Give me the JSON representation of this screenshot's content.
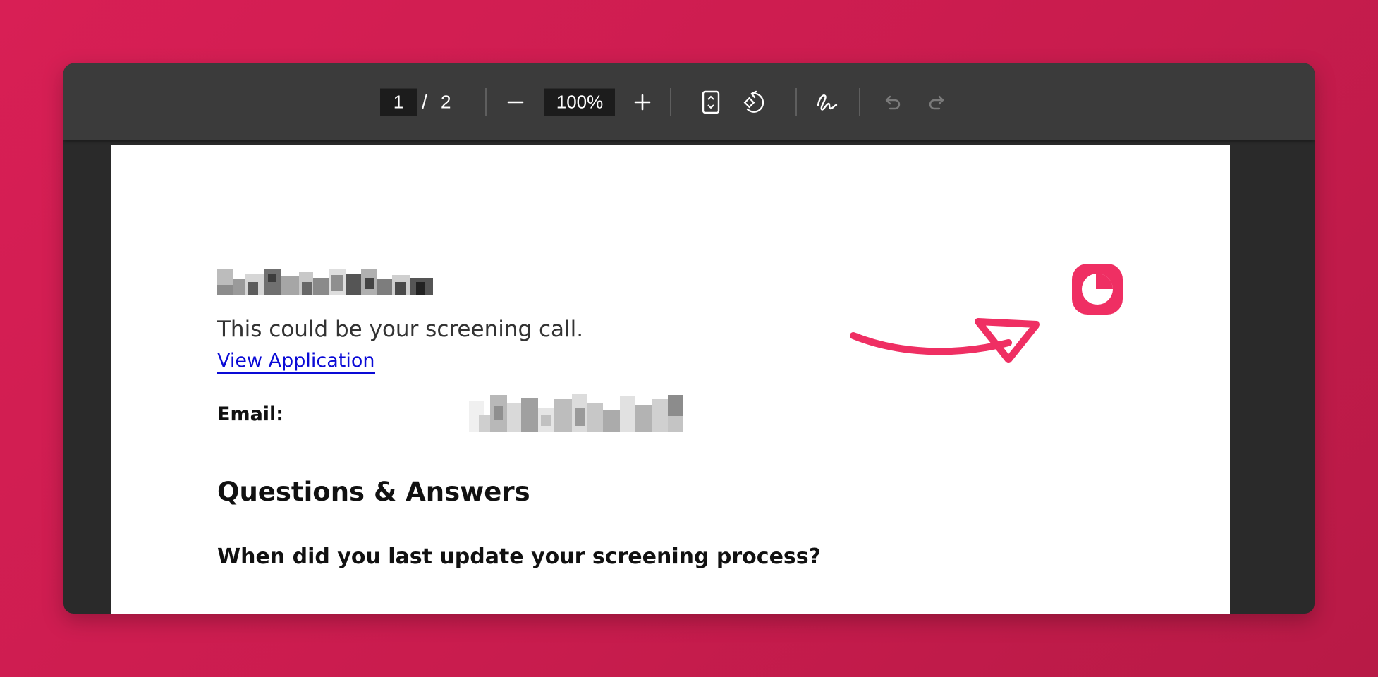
{
  "toolbar": {
    "current_page": "1",
    "page_separator": "/",
    "total_pages": "2",
    "zoom": "100%",
    "icons": [
      "zoom-out-icon",
      "zoom-in-icon",
      "fit-page-icon",
      "rotate-icon",
      "draw-icon",
      "undo-icon",
      "redo-icon"
    ]
  },
  "document": {
    "subtitle": "This could be your screening call.",
    "link_text": "View Application",
    "email_label": "Email:",
    "section_heading": "Questions & Answers",
    "question": "When did you last update your screening process?"
  },
  "colors": {
    "background": "#d81f55",
    "accent": "#ef2f63",
    "link": "#0a0ad6"
  }
}
